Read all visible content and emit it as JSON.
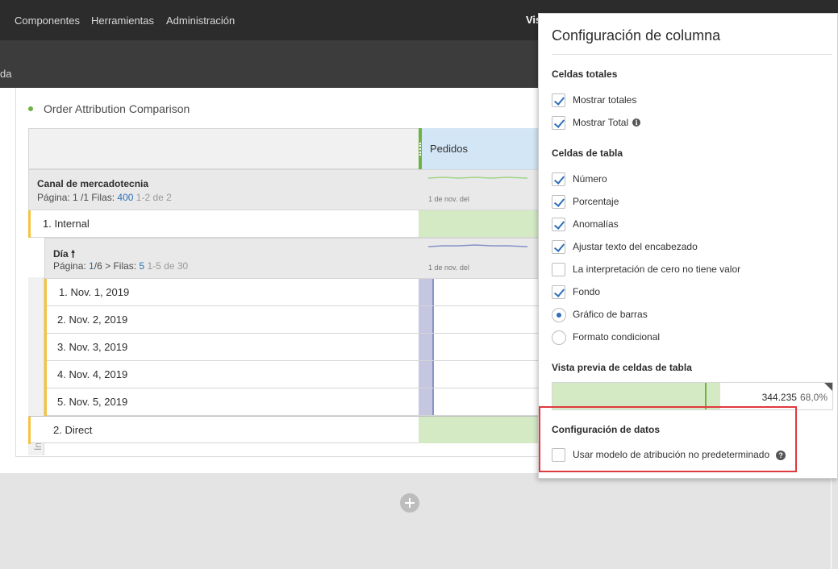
{
  "topbar": {
    "items": [
      "Componentes",
      "Herramientas",
      "Administración"
    ],
    "partial_label": "Vis"
  },
  "subbar": {
    "crumb": "da"
  },
  "panel": {
    "title": "Order Attribution Comparison"
  },
  "table": {
    "metric": "Pedidos",
    "dimension1": {
      "name": "Canal de mercadotecnia",
      "page_label": "Página: 1 /1",
      "rows_label": "Filas:",
      "rows_value": "400",
      "range": "1-2 de 2",
      "spark_date": "1 de nov. del"
    },
    "row1": "1. Internal",
    "dimension2": {
      "name": "Día",
      "page_prefix": "Página:",
      "page_value": "1",
      "page_total": "/6",
      "rows_label": "Filas:",
      "rows_value": "5",
      "range": "1-5 de 30",
      "spark_date": "1 de nov. del"
    },
    "subrows": [
      "1. Nov. 1, 2019",
      "2. Nov. 2, 2019",
      "3. Nov. 3, 2019",
      "4. Nov. 4, 2019",
      "5. Nov. 5, 2019"
    ],
    "internal_side": "Internal",
    "row2": "2. Direct"
  },
  "popover": {
    "title": "Configuración de columna",
    "total_cells": {
      "heading": "Celdas totales",
      "options": [
        "Mostrar totales",
        "Mostrar Total"
      ]
    },
    "table_cells": {
      "heading": "Celdas de tabla",
      "options": [
        "Número",
        "Porcentaje",
        "Anomalías",
        "Ajustar texto del encabezado",
        "La interpretación de cero no tiene valor",
        "Fondo"
      ],
      "radios": [
        "Gráfico de barras",
        "Formato condicional"
      ]
    },
    "preview": {
      "heading": "Vista previa de celdas de tabla",
      "value": "344.235",
      "percent": "68,0%"
    },
    "data_settings": {
      "heading": "Configuración de datos",
      "option": "Usar modelo de atribución no predeterminado"
    }
  },
  "colors": {
    "accent_blue": "#2d6fb8",
    "green": "#6db33f",
    "highlight_red": "#e0393e",
    "yellow_bar": "#f5c342"
  }
}
